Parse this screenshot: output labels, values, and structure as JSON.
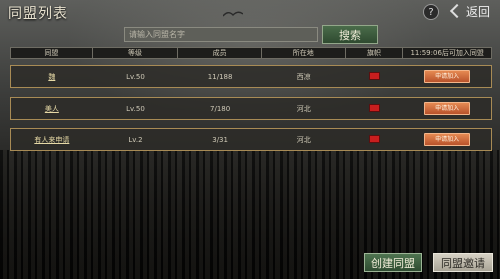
{
  "header": {
    "title": "同盟列表",
    "help_label": "?",
    "back_label": "返回"
  },
  "search": {
    "placeholder": "请输入同盟名字",
    "button_label": "搜索"
  },
  "table": {
    "columns": [
      "同盟",
      "等级",
      "成员",
      "所在地",
      "旗帜",
      "11:59:06后可加入同盟"
    ],
    "rows": [
      {
        "name": "魏",
        "level": "Lv.50",
        "members": "11/188",
        "location": "西凉",
        "action": "申请加入"
      },
      {
        "name": "美人",
        "level": "Lv.50",
        "members": "7/180",
        "location": "河北",
        "action": "申请加入"
      },
      {
        "name": "有人来申请",
        "level": "Lv.2",
        "members": "3/31",
        "location": "河北",
        "action": "申请加入"
      }
    ]
  },
  "footer": {
    "create_label": "创建同盟",
    "invite_label": "同盟邀请"
  },
  "colors": {
    "flag": "#c81e1e",
    "apply_button": "#d46d3e",
    "green_button": "#3f5f40",
    "row_border": "#a88b55"
  }
}
